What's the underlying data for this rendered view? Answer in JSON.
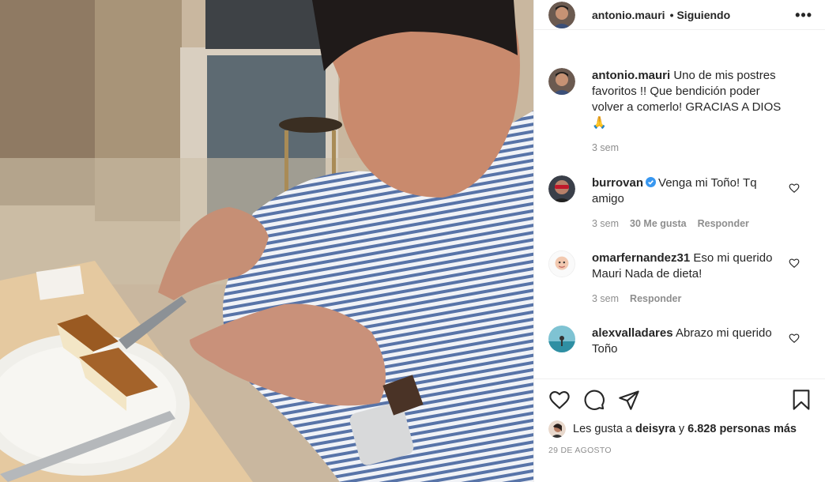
{
  "post": {
    "author": "antonio.mauri",
    "follow_separator": "•",
    "follow_status": "Siguiendo",
    "more_glyph": "•••"
  },
  "caption": {
    "user": "antonio.mauri",
    "text": "Uno de mis postres favoritos !! Que bendición poder volver a comerlo! GRACIAS A DIOS",
    "emoji": "🙏",
    "time": "3 sem"
  },
  "comments": [
    {
      "user": "burrovan",
      "verified": true,
      "text": "Venga mi Toño! Tq amigo",
      "time": "3 sem",
      "likes": "30 Me gusta",
      "reply": "Responder"
    },
    {
      "user": "omarfernandez31",
      "verified": false,
      "text": "Eso mi querido Mauri Nada de dieta!",
      "time": "3 sem",
      "reply": "Responder"
    },
    {
      "user": "alexvalladares",
      "verified": false,
      "text": "Abrazo mi querido Toño"
    }
  ],
  "likes": {
    "prefix": "Les gusta a",
    "first_user": "deisyra",
    "joiner": "y",
    "others": "6.828 personas más"
  },
  "date": "29 DE AGOSTO",
  "icons": [
    "heart-icon",
    "comment-icon",
    "share-icon",
    "bookmark-icon",
    "more-icon",
    "verified-icon"
  ],
  "colors": {
    "verified": "#3897f0",
    "meta_gray": "#8e8e8e",
    "text": "#262626"
  }
}
